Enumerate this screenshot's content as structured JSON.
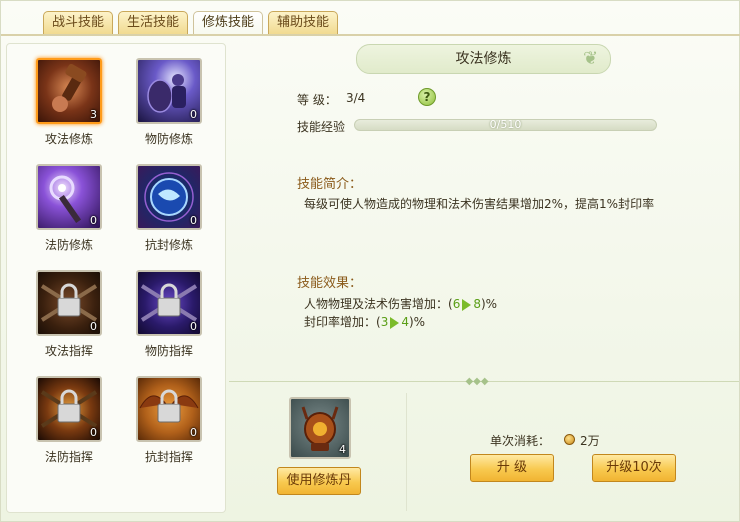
{
  "tabs": [
    {
      "label": "战斗技能",
      "active": false
    },
    {
      "label": "生活技能",
      "active": false
    },
    {
      "label": "修炼技能",
      "active": true
    },
    {
      "label": "辅助技能",
      "active": false
    }
  ],
  "skills": [
    {
      "name": "攻法修炼",
      "count": "3",
      "icon": "hammer-fist-icon",
      "selected": true
    },
    {
      "name": "物防修炼",
      "count": "0",
      "icon": "shield-warrior-icon"
    },
    {
      "name": "法防修炼",
      "count": "0",
      "icon": "magic-staff-icon"
    },
    {
      "name": "抗封修炼",
      "count": "0",
      "icon": "blue-orb-icon"
    },
    {
      "name": "攻法指挥",
      "count": "0",
      "icon": "chain-lock-icon"
    },
    {
      "name": "物防指挥",
      "count": "0",
      "icon": "chain-lock-purple-icon"
    },
    {
      "name": "法防指挥",
      "count": "0",
      "icon": "chain-lock-fire-icon"
    },
    {
      "name": "抗封指挥",
      "count": "0",
      "icon": "chain-lock-wings-icon"
    }
  ],
  "detail": {
    "title": "攻法修炼",
    "level_label": "等  级：",
    "level_value": "3/4",
    "help": "?",
    "exp_label": "技能经验",
    "exp_text": "0/510",
    "exp_progress": 0,
    "intro_title": "技能简介：",
    "intro_text": "每级可使人物造成的物理和法术伤害结果增加2%，提高1%封印率",
    "effect_title": "技能效果：",
    "effects": [
      {
        "prefix": "人物物理及法术伤害增加：(",
        "from": "6",
        "to": "8",
        "suffix": ")%"
      },
      {
        "prefix": "封印率增加：(",
        "from": "3",
        "to": "4",
        "suffix": ")%"
      }
    ]
  },
  "bottom": {
    "item_count": "4",
    "item_icon": "cultivation-pill-icon",
    "use_button": "使用修炼丹",
    "cost_label": "单次消耗：",
    "cost_value": "2万",
    "upgrade_button": "升 级",
    "upgrade10_button": "升级10次"
  },
  "colors": {
    "accent": "#f8c94f",
    "section_title": "#8a5a1a",
    "green": "#5a9e16"
  }
}
